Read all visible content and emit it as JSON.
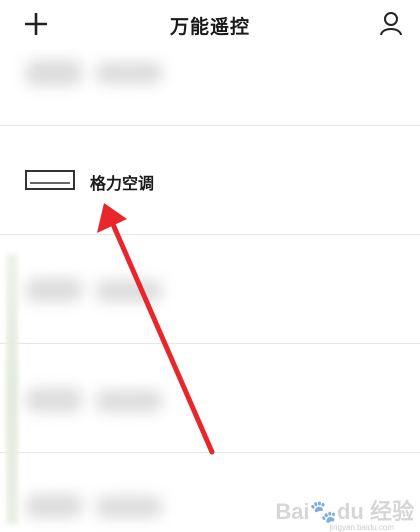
{
  "header": {
    "title": "万能遥控",
    "add_icon": "plus-icon",
    "user_icon": "user-icon"
  },
  "device": {
    "name": "格力空调",
    "icon": "air-conditioner-icon"
  },
  "annotation": {
    "arrow_color": "#e8262b"
  },
  "watermark": {
    "brand": "Bai",
    "brand_mark": "du",
    "brand_cn": "经验",
    "url": "jingyan.baidu.com"
  }
}
